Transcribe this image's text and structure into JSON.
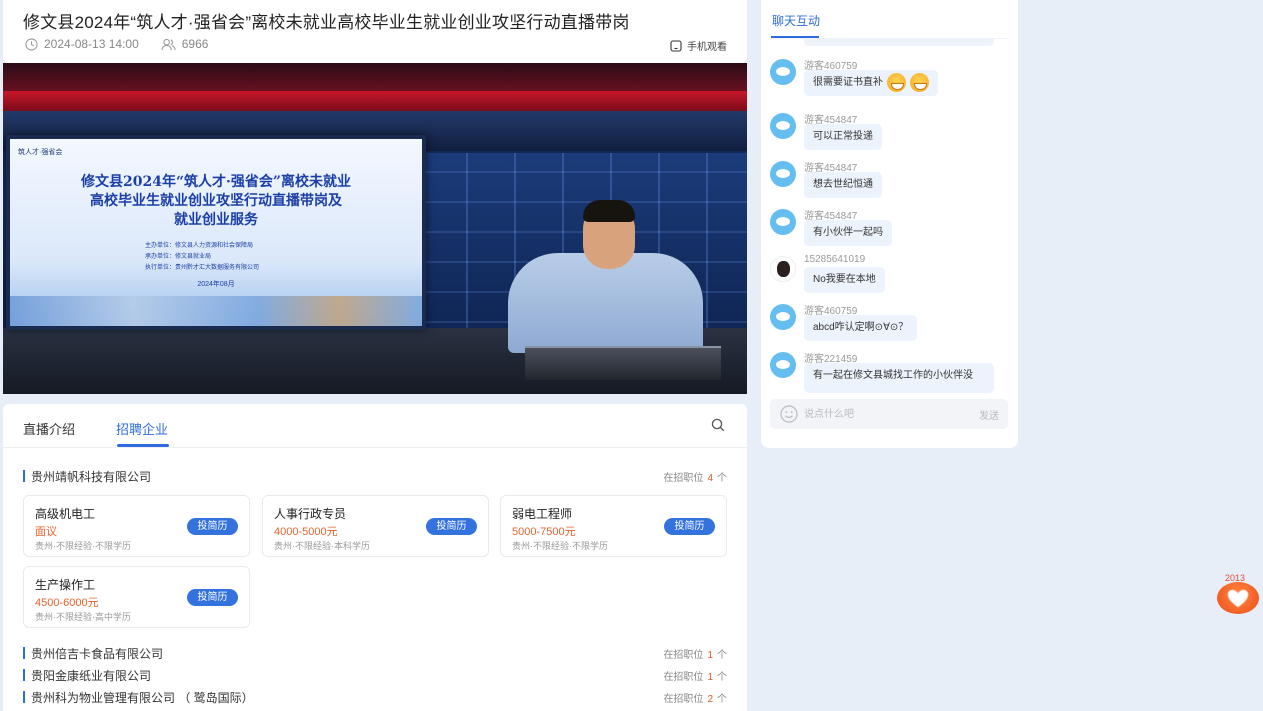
{
  "header": {
    "title": "修文县2024年“筑人才·强省会”离校未就业高校毕业生就业创业攻坚行动直播带岗",
    "date": "2024-08-13 14:00",
    "views": "6966",
    "mobile_label": "手机观看"
  },
  "video": {
    "logo": "筑人才·强省会",
    "screen_title_1": "修文县2024年“筑人才·强省会”离校未就业",
    "screen_title_2": "高校毕业生就业创业攻坚行动直播带岗及",
    "screen_title_3": "就业创业服务",
    "org_1": "主办单位：修文县人力资源和社会保障局",
    "org_2": "承办单位：修文县就业局",
    "org_3": "执行单位：贵州黔才汇大数据服务有限公司",
    "screen_date": "2024年08月"
  },
  "tabs": [
    {
      "label": "直播介绍"
    },
    {
      "label": "招聘企业"
    }
  ],
  "companies": [
    {
      "name": "贵州靖帆科技有限公司",
      "count_prefix": "在招职位",
      "count": "4",
      "count_suffix": "个",
      "jobs": [
        {
          "title": "高级机电工",
          "salary": "面议",
          "desc": "贵州·不限经验·不限学历",
          "button": "投简历"
        },
        {
          "title": "人事行政专员",
          "salary": "4000-5000元",
          "desc": "贵州·不限经验·本科学历",
          "button": "投简历"
        },
        {
          "title": "弱电工程师",
          "salary": "5000-7500元",
          "desc": "贵州·不限经验·不限学历",
          "button": "投简历"
        },
        {
          "title": "生产操作工",
          "salary": "4500-6000元",
          "desc": "贵州·不限经验·高中学历",
          "button": "投简历"
        }
      ]
    },
    {
      "name": "贵州倍吉卡食品有限公司",
      "count_prefix": "在招职位",
      "count": "1",
      "count_suffix": "个"
    },
    {
      "name": "贵阳金康纸业有限公司",
      "count_prefix": "在招职位",
      "count": "1",
      "count_suffix": "个"
    },
    {
      "name": "贵州科为物业管理有限公司 （ 鹭岛国际）",
      "count_prefix": "在招职位",
      "count": "2",
      "count_suffix": "个"
    }
  ],
  "chat": {
    "tab": "聊天互动",
    "messages": [
      {
        "nick": "游客460759",
        "text": "很需要证书直补"
      },
      {
        "nick": "游客454847",
        "text": "可以正常投递"
      },
      {
        "nick": "游客454847",
        "text": "想去世纪恒通"
      },
      {
        "nick": "游客454847",
        "text": "有小伙伴一起吗"
      },
      {
        "nick": "15285641019",
        "text": "No我要在本地"
      },
      {
        "nick": "游客460759",
        "text": "abcd咋认定啊⊙∀⊙？"
      },
      {
        "nick": "游客221459",
        "text": "有一起在修文县城找工作的小伙伴没"
      }
    ],
    "input_placeholder": "说点什么吧",
    "send_label": "发送"
  },
  "like": {
    "count": "2013"
  },
  "colors": {
    "accent": "#2f6bdc",
    "salary": "#e8632d",
    "like": "#ee4a1d"
  }
}
